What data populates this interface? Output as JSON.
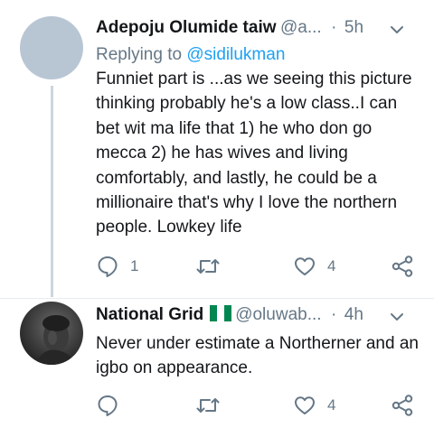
{
  "tweets": [
    {
      "author_name": "Adepoju Olumide taiw",
      "author_handle": "@a...",
      "separator": "·",
      "time": "5h",
      "replying_prefix": "Replying to ",
      "replying_to": "@sidilukman",
      "text": "Funniet part is ...as we seeing  this picture thinking probably he's a low class..I can bet wit ma life that 1) he who don go mecca 2) he has wives and living comfortably, and lastly, he could be a millionaire that's why I love the northern people. Lowkey life",
      "replies": "1",
      "retweets": "",
      "likes": "4",
      "avatar": "grey-placeholder"
    },
    {
      "author_name": "National Grid",
      "author_badge": "nigeria-flag-emoji",
      "author_handle": "@oluwab...",
      "separator": "·",
      "time": "4h",
      "text": "Never under estimate a Northerner and an igbo on appearance.",
      "replies": "",
      "retweets": "",
      "likes": "4",
      "avatar": "photo"
    }
  ],
  "icons": {
    "reply": "speech-bubble-icon",
    "retweet": "retweet-icon",
    "like": "heart-icon",
    "share": "share-icon",
    "menu": "chevron-down-icon"
  },
  "colors": {
    "text": "#14171a",
    "secondary": "#657786",
    "link": "#1da1f2",
    "thread_line": "#ccd6dd",
    "avatar_placeholder": "#b8c6d4"
  }
}
